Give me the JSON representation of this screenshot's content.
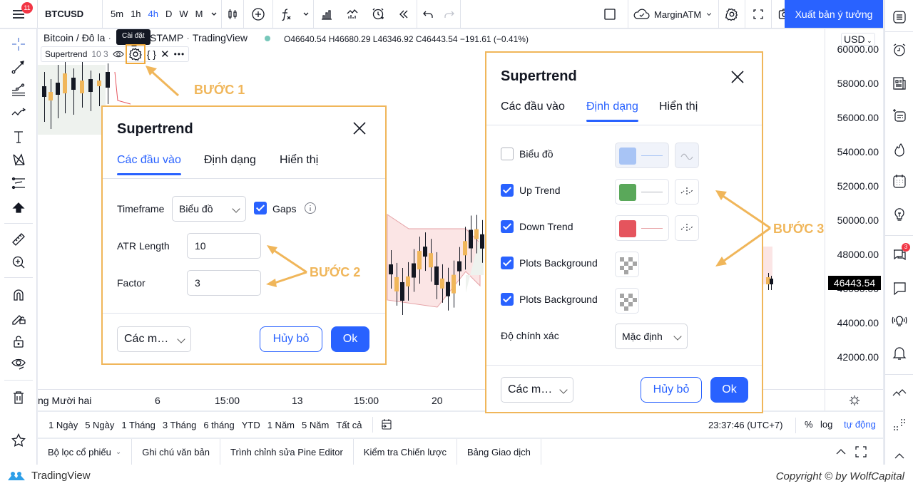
{
  "topbar": {
    "menu_badge": "11",
    "symbol": "BTCUSD",
    "timeframes": [
      {
        "label": "5m",
        "active": false
      },
      {
        "label": "1h",
        "active": false
      },
      {
        "label": "4h",
        "active": true
      },
      {
        "label": "D",
        "active": false
      },
      {
        "label": "W",
        "active": false
      },
      {
        "label": "M",
        "active": false
      }
    ],
    "layout_name": "MarginATM",
    "publish_label": "Xuất bản ý tưởng"
  },
  "chart": {
    "title": "Bitcoin / Đô la",
    "exchange": "STAMP",
    "source": "TradingView",
    "ohlc": "O46640.54 H46680.29 L46346.92 C46443.54 −191.61 (−0.41%)",
    "tooltip": "Cài đặt",
    "indicator_name": "Supertrend",
    "indicator_params": "10 3",
    "currency": "USD",
    "last_price": "46443.54",
    "price_labels": [
      "60000.00",
      "58000.00",
      "56000.00",
      "54000.00",
      "52000.00",
      "50000.00",
      "48000.00",
      "46000.00",
      "44000.00",
      "42000.00"
    ],
    "time_labels": [
      "ng Mười hai",
      "6",
      "15:00",
      "13",
      "15:00",
      "20"
    ]
  },
  "range_bar": {
    "ranges": [
      "1 Ngày",
      "5 Ngày",
      "1 Tháng",
      "3 Tháng",
      "6 tháng",
      "YTD",
      "1 Năm",
      "5 Năm",
      "Tất cả"
    ],
    "clock": "23:37:46 (UTC+7)",
    "percent": "%",
    "log": "log",
    "auto": "tự động"
  },
  "panel_tabs": [
    "Bộ lọc cổ phiếu",
    "Ghi chú văn bản",
    "Trình chỉnh sửa Pine Editor",
    "Kiểm tra Chiến lược",
    "Bảng Giao dịch"
  ],
  "right_sidebar": {
    "chat_badge": "3"
  },
  "dialog_inputs": {
    "title": "Supertrend",
    "tabs": [
      "Các đầu vào",
      "Định dạng",
      "Hiển thị"
    ],
    "active_tab": 0,
    "timeframe_label": "Timeframe",
    "timeframe_value": "Biểu đồ",
    "gaps_label": "Gaps",
    "gaps_checked": true,
    "atr_label": "ATR Length",
    "atr_value": "10",
    "factor_label": "Factor",
    "factor_value": "3",
    "defaults_label": "Các m…",
    "cancel_label": "Hủy bỏ",
    "ok_label": "Ok"
  },
  "dialog_style": {
    "title": "Supertrend",
    "tabs": [
      "Các đầu vào",
      "Định dạng",
      "Hiển thị"
    ],
    "active_tab": 1,
    "rows": [
      {
        "label": "Biểu đồ",
        "checked": false,
        "color": "#a8c4f5"
      },
      {
        "label": "Up Trend",
        "checked": true,
        "color": "#5aa85a"
      },
      {
        "label": "Down Trend",
        "checked": true,
        "color": "#e5545d"
      },
      {
        "label": "Plots Background",
        "checked": true
      },
      {
        "label": "Plots Background",
        "checked": true
      }
    ],
    "precision_label": "Độ chính xác",
    "precision_value": "Mặc định",
    "defaults_label": "Các m…",
    "cancel_label": "Hủy bỏ",
    "ok_label": "Ok"
  },
  "annotations": {
    "step1": "BƯỚC 1",
    "step2": "BƯỚC 2",
    "step3": "BƯỚC 3"
  },
  "footer": {
    "brand": "TradingView",
    "copyright": "Copyright © by WolfCapital"
  },
  "colors": {
    "accent": "#2962ff",
    "annotation": "#f0b65a",
    "up_candle": "#f0b65a",
    "down_candle": "#131722"
  }
}
